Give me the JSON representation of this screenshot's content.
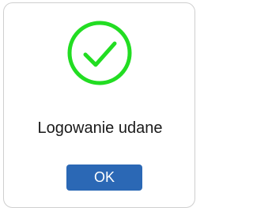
{
  "dialog": {
    "icon": "checkmark-circle-icon",
    "icon_color": "#22dd22",
    "message": "Logowanie udane",
    "ok_label": "OK",
    "button_color": "#2b68b5"
  }
}
